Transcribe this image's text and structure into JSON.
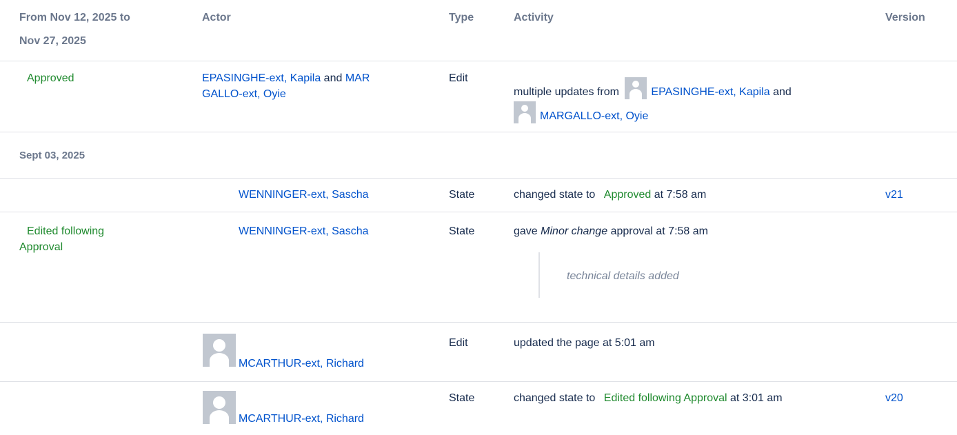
{
  "header": {
    "date_range": [
      "From Nov 12, 2025 to",
      "Nov 27, 2025"
    ],
    "actor": "Actor",
    "type": "Type",
    "activity": "Activity",
    "version": "Version"
  },
  "group1": {
    "status": "Approved",
    "actor1": "EPASINGHE-ext, Kapila",
    "actor_and": "and",
    "actor2_line1": "MAR",
    "actor2_line2": "GALLO-ext, Oyie",
    "type": "Edit",
    "activity_prefix": "multiple updates from",
    "activity_user1": "EPASINGHE-ext, Kapila",
    "activity_and": "and",
    "activity_user2": "MARGALLO-ext, Oyie"
  },
  "group2": {
    "date": "Sept 03, 2025",
    "rows": [
      {
        "actor": "WENNINGER-ext, Sascha",
        "type": "State",
        "activity_prefix": "changed state to",
        "activity_state": "Approved",
        "activity_suffix": "at 7:58 am",
        "version": "v21"
      },
      {
        "status_line1": "Edited following",
        "status_line2": "Approval",
        "actor": "WENNINGER-ext, Sascha",
        "type": "State",
        "activity_prefix": "gave",
        "activity_em": "Minor change",
        "activity_suffix": "approval at 7:58 am",
        "comment": "technical details added"
      },
      {
        "actor": "MCARTHUR-ext, Richard",
        "type": "Edit",
        "activity": "updated the page at 5:01 am"
      },
      {
        "actor": "MCARTHUR-ext, Richard",
        "type": "State",
        "activity_prefix": "changed state to",
        "activity_state": "Edited following Approval",
        "activity_suffix": "at 3:01 am",
        "version": "v20"
      }
    ]
  },
  "colors": {
    "link": "#0052cc",
    "status_green": "#1f8a2e",
    "header_gray": "#6b778c",
    "divider": "#dfe1e6",
    "avatar_bg": "#c1c7d0"
  }
}
